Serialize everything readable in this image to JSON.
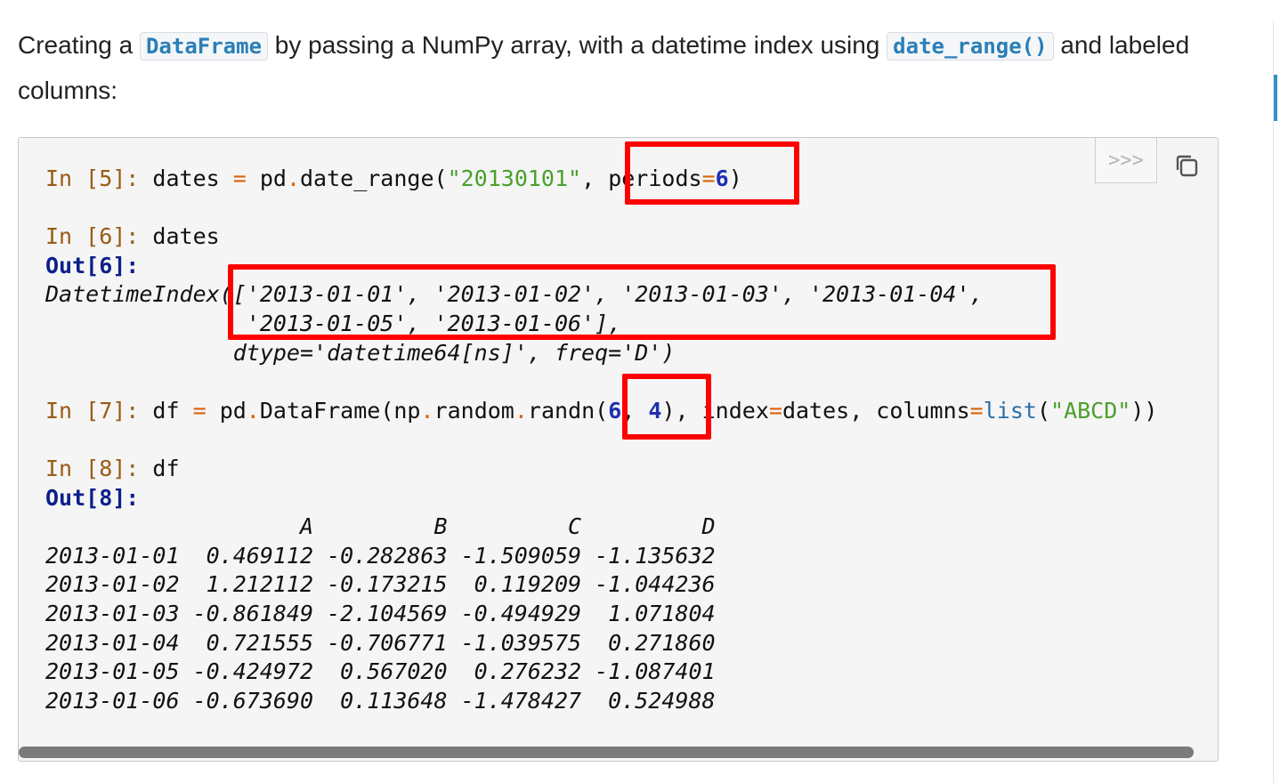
{
  "intro": {
    "t1": "Creating a ",
    "code1": "DataFrame",
    "t2": " by passing a NumPy array, with a datetime index using ",
    "code2": "date_range()",
    "t3": " and labeled columns:"
  },
  "code_toolbar": {
    "prompt_toggle": ">>>",
    "copy_icon": "copy-icon"
  },
  "cells": {
    "in5": {
      "prompt": "In [5]:",
      "p1": " dates ",
      "p2": "=",
      "p3": " pd",
      "p4": ".",
      "p5": "date_range(",
      "p6": "\"20130101\"",
      "p7": ", periods",
      "p8": "=",
      "p9": "6",
      "p10": ")"
    },
    "in6": {
      "prompt": "In [6]:",
      "code": " dates"
    },
    "out6": {
      "prompt": "Out[6]:",
      "line1": "DatetimeIndex(['2013-01-01', '2013-01-02', '2013-01-03', '2013-01-04',",
      "line2": "               '2013-01-05', '2013-01-06'],",
      "line3": "              dtype='datetime64[ns]', freq='D')"
    },
    "in7": {
      "prompt": "In [7]:",
      "p1": " df ",
      "p2": "=",
      "p3": " pd",
      "p4": ".",
      "p5": "DataFrame(np",
      "p6": ".",
      "p7": "random",
      "p8": ".",
      "p9": "randn(",
      "p10": "6",
      "p11": ", ",
      "p12": "4",
      "p13": "), index",
      "p14": "=",
      "p15": "dates, columns",
      "p16": "=",
      "p17": "list",
      "p18": "(",
      "p19": "\"ABCD\"",
      "p20": "))"
    },
    "in8": {
      "prompt": "In [8]:",
      "code": " df"
    },
    "out8": {
      "prompt": "Out[8]:",
      "header": "                   A         B         C         D",
      "rows": [
        "2013-01-01  0.469112 -0.282863 -1.509059 -1.135632",
        "2013-01-02  1.212112 -0.173215  0.119209 -1.044236",
        "2013-01-03 -0.861849 -2.104569 -0.494929  1.071804",
        "2013-01-04  0.721555 -0.706771 -1.039575  0.271860",
        "2013-01-05 -0.424972  0.567020  0.276232 -1.087401",
        "2013-01-06 -0.673690  0.113648 -1.478427  0.524988"
      ]
    }
  }
}
